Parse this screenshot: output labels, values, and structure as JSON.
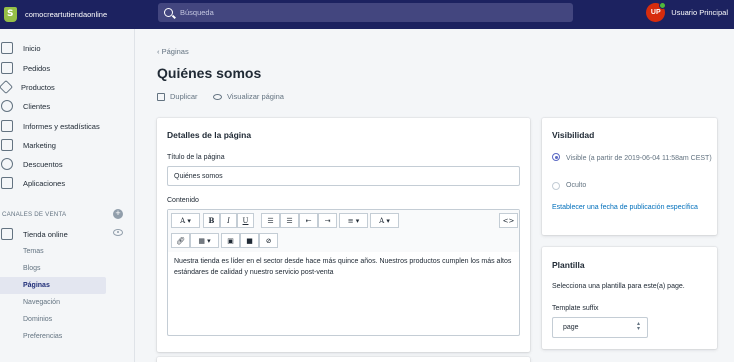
{
  "topbar": {
    "store_name": "comocreartutiendaonline",
    "search_placeholder": "Búsqueda",
    "user_initials": "UP",
    "user_name": "Usuario Principal"
  },
  "sidebar": {
    "items": [
      {
        "label": "Inicio",
        "icon": "home-icon"
      },
      {
        "label": "Pedidos",
        "icon": "orders-icon"
      },
      {
        "label": "Productos",
        "icon": "tag-icon"
      },
      {
        "label": "Clientes",
        "icon": "person-icon"
      },
      {
        "label": "Informes y estadísticas",
        "icon": "bar-chart-icon"
      },
      {
        "label": "Marketing",
        "icon": "megaphone-icon"
      },
      {
        "label": "Descuentos",
        "icon": "discount-icon"
      },
      {
        "label": "Aplicaciones",
        "icon": "apps-icon"
      }
    ],
    "channels_title": "CANALES DE VENTA",
    "channel": "Tienda online",
    "sub_items": [
      "Temas",
      "Blogs",
      "Páginas",
      "Navegación",
      "Dominios",
      "Preferencias"
    ],
    "active_sub_item": "Páginas"
  },
  "main": {
    "breadcrumb": "Páginas",
    "title": "Quiénes somos",
    "actions": {
      "duplicate": "Duplicar",
      "view": "Visualizar página"
    },
    "details_card": {
      "heading": "Detalles de la página",
      "title_label": "Título de la página",
      "title_value": "Quiénes somos",
      "content_label": "Contenido",
      "content_text": "Nuestra tienda es líder en el sector desde hace más quince años. Nuestros productos cumplen los más altos estándares de calidad y nuestro servicio post-venta"
    },
    "editor_toolbar": {
      "font": "A",
      "bold": "B",
      "italic": "I",
      "underline": "U",
      "color": "A",
      "source": "<>"
    }
  },
  "visibility_card": {
    "heading": "Visibilidad",
    "visible_option": "Visible (a partir de 2019-06-04 11:58am CEST)",
    "hidden_option": "Oculto",
    "set_date_link": "Establecer una fecha de publicación específica",
    "selected": "visible"
  },
  "template_card": {
    "heading": "Plantilla",
    "description": "Selecciona una plantilla para este(a) page.",
    "suffix_label": "Template suffix",
    "suffix_value": "page"
  },
  "colors": {
    "topbar": "#1c2260",
    "accent": "#5c6ac4",
    "link": "#006fbb",
    "avatar": "#d72c0d",
    "logo": "#95bf47"
  }
}
